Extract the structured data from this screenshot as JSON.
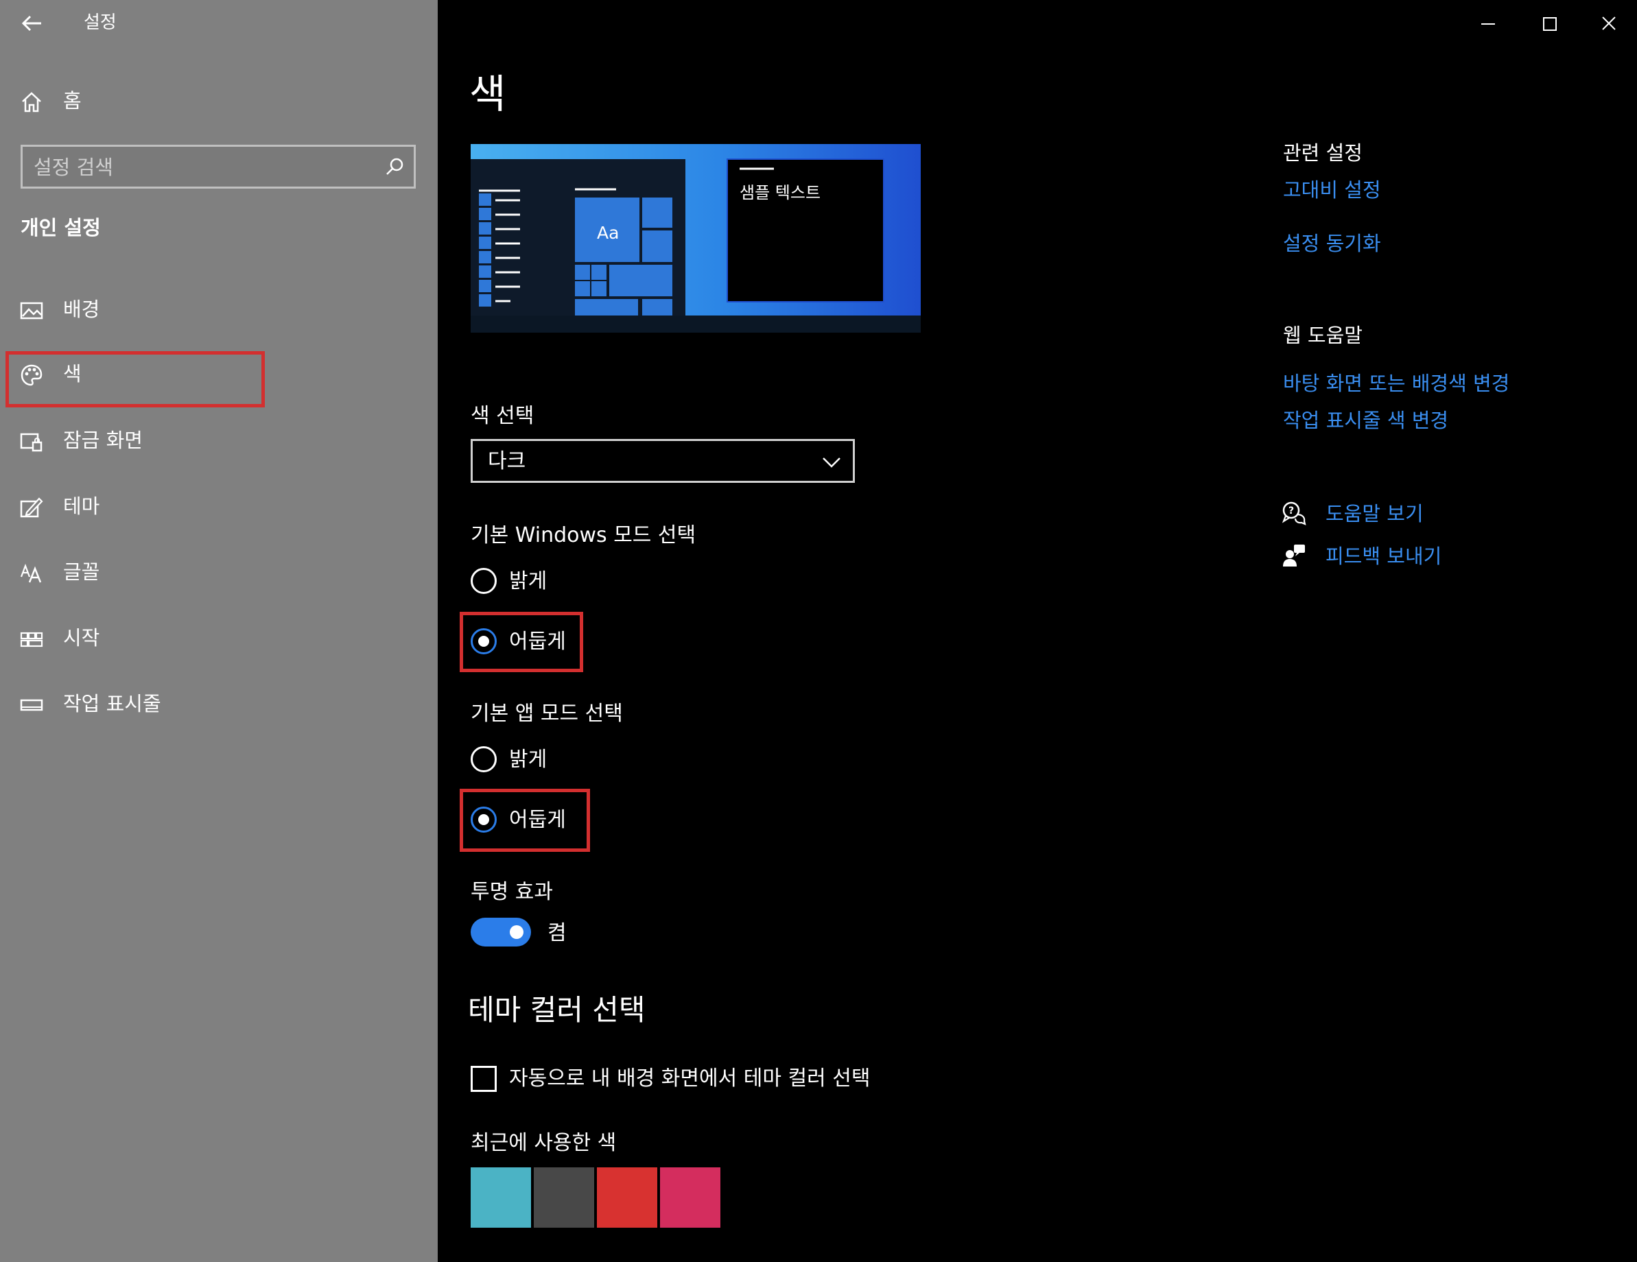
{
  "window": {
    "title": "설정",
    "controls": [
      "minimize-icon",
      "maximize-icon",
      "close-icon"
    ]
  },
  "sidebar": {
    "home_label": "홈",
    "search_placeholder": "설정 검색",
    "section_title": "개인 설정",
    "items": [
      {
        "label": "배경",
        "icon": "image-icon"
      },
      {
        "label": "색",
        "icon": "palette-icon",
        "selected": true
      },
      {
        "label": "잠금 화면",
        "icon": "lock-screen-icon"
      },
      {
        "label": "테마",
        "icon": "theme-icon"
      },
      {
        "label": "글꼴",
        "icon": "font-icon"
      },
      {
        "label": "시작",
        "icon": "start-icon"
      },
      {
        "label": "작업 표시줄",
        "icon": "taskbar-icon"
      }
    ]
  },
  "main": {
    "page_title": "색",
    "preview": {
      "sample_text": "샘플 텍스트",
      "tile_text": "Aa"
    },
    "color_select": {
      "label": "색 선택",
      "value": "다크"
    },
    "windows_mode": {
      "label": "기본 Windows 모드 선택",
      "options": [
        "밝게",
        "어둡게"
      ],
      "selected": "어둡게"
    },
    "app_mode": {
      "label": "기본 앱 모드 선택",
      "options": [
        "밝게",
        "어둡게"
      ],
      "selected": "어둡게"
    },
    "transparency": {
      "label": "투명 효과",
      "state": "켬",
      "on": true
    },
    "accent": {
      "heading": "테마 컬러 선택",
      "auto_label": "자동으로 내 배경 화면에서 테마 컬러 선택",
      "auto_checked": false,
      "recent_label": "최근에 사용한 색",
      "recent_colors": [
        "#4bb3c5",
        "#484848",
        "#d83230",
        "#d42d5e"
      ]
    }
  },
  "related": {
    "heading": "관련 설정",
    "links": [
      "고대비 설정",
      "설정 동기화"
    ]
  },
  "web_help": {
    "heading": "웹 도움말",
    "links": [
      "바탕 화면 또는 배경색 변경",
      "작업 표시줄 색 변경"
    ]
  },
  "support": {
    "get_help": "도움말 보기",
    "feedback": "피드백 보내기"
  },
  "colors": {
    "accent": "#2b7de9",
    "link": "#3a8ef0",
    "highlight": "#d32f2f",
    "sidebar_bg": "#808080"
  }
}
